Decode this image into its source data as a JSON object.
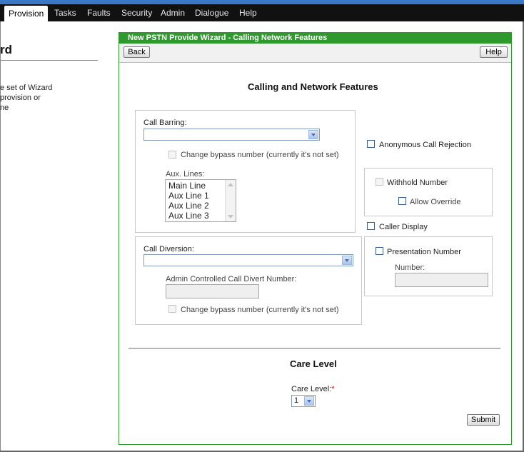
{
  "menu": {
    "items": [
      {
        "label": "Provision",
        "active": true
      },
      {
        "label": "Tasks"
      },
      {
        "label": "Faults"
      },
      {
        "label": "Security"
      },
      {
        "label": "Admin"
      },
      {
        "label": "Dialogue"
      },
      {
        "label": "Help"
      }
    ]
  },
  "left_panel": {
    "title": "rd",
    "lines": [
      "e set of Wizard",
      "provision or",
      "ne"
    ]
  },
  "wizard": {
    "title": "New PSTN Provide Wizard - Calling Network Features",
    "back_label": "Back",
    "help_label": "Help",
    "section1_title": "Calling and Network Features",
    "call_barring": {
      "label": "Call Barring:",
      "value": "",
      "bypass_label": "Change bypass number (currently it's not set)",
      "aux_label": "Aux. Lines:",
      "aux_lines": [
        "Main Line",
        "Aux Line 1",
        "Aux Line 2",
        "Aux Line 3"
      ]
    },
    "call_diversion": {
      "label": "Call Diversion:",
      "value": "",
      "admin_divert_label": "Admin Controlled Call Divert Number:",
      "admin_divert_value": "",
      "bypass_label": "Change bypass number (currently it's not set)"
    },
    "anonymous_label": "Anonymous Call Rejection",
    "withhold_label": "Withhold Number",
    "allow_override_label": "Allow Override",
    "caller_display_label": "Caller Display",
    "presentation_label": "Presentation Number",
    "number_label": "Number:",
    "number_value": "",
    "section2_title": "Care Level",
    "care_level_label": "Care Level:",
    "care_level_required": "*",
    "care_level_value": "1",
    "submit_label": "Submit"
  },
  "colors": {
    "menu_bg": "#111111",
    "accent_blue": "#3c78c8",
    "wizard_green": "#2e9a2e",
    "required_red": "#dd0000"
  }
}
